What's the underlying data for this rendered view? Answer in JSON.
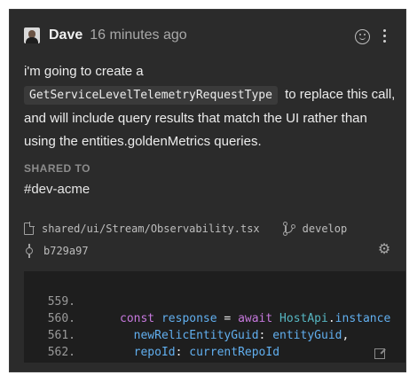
{
  "post": {
    "author": "Dave",
    "timestamp": "16 minutes ago",
    "avatar_icon": "user-avatar",
    "message_before": "i'm going to create a",
    "message_code": "GetServiceLevelTelemetryRequestType",
    "message_after": "to replace this call, and will include query results that match the UI rather than using the entities.goldenMetrics queries.",
    "shared_to_label": "SHARED TO",
    "channel": "#dev-acme"
  },
  "code_ref": {
    "file_path": "shared/ui/Stream/Observability.tsx",
    "branch": "develop",
    "commit": "b729a97"
  },
  "code_lines": [
    {
      "num": "559.",
      "text": "const response = await HostApi.instance"
    },
    {
      "num": "560.",
      "text": "  newRelicEntityGuid: entityGuid,"
    },
    {
      "num": "561.",
      "text": "  repoId: currentRepoId"
    },
    {
      "num": "562.",
      "text": "});"
    }
  ],
  "icons": [
    "emoji-reaction-icon",
    "kebab-menu-icon",
    "file-icon",
    "branch-icon",
    "commit-icon",
    "gear-icon",
    "open-external-icon"
  ],
  "colors": {
    "background": "#2b2b2b",
    "code_background": "#1e1e1e",
    "keyword": "#c678dd",
    "identifier": "#61afef"
  }
}
